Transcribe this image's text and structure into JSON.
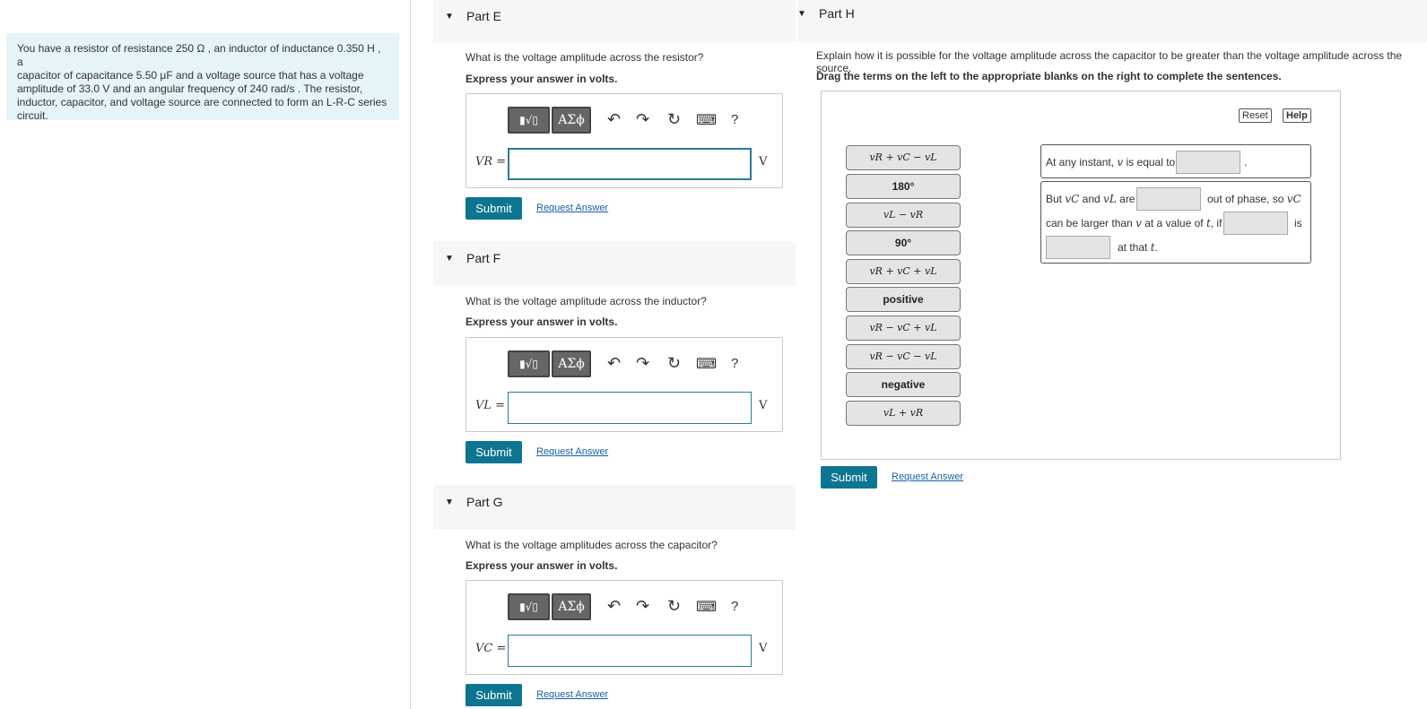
{
  "problem": {
    "p1": "You have a resistor of resistance 250 Ω , an inductor of inductance 0.350 H , a",
    "p2": "capacitor of capacitance 5.50 μF and a voltage source that has a voltage",
    "p3": "amplitude of 33.0 V and an angular frequency of 240 rad/s . The resistor,",
    "p4": "inductor, capacitor, and voltage source are connected to form an L-R-C series",
    "p5": "circuit."
  },
  "toolbar": {
    "template_glyph": "▮√▯",
    "greek_glyph": "ΑΣϕ",
    "undo_glyph": "↶",
    "redo_glyph": "↷",
    "reset_glyph": "↻",
    "keyboard_glyph": "⌨",
    "help_glyph": "?"
  },
  "common": {
    "express": "Express your answer in volts.",
    "submit": "Submit",
    "request": "Request Answer",
    "unit": "V"
  },
  "partE": {
    "title": "Part E",
    "question": "What is the voltage amplitude across the resistor?",
    "var": "VR ="
  },
  "partF": {
    "title": "Part F",
    "question": "What is the voltage amplitude across the inductor?",
    "var": "VL ="
  },
  "partG": {
    "title": "Part G",
    "question": "What is the voltage amplitudes across the capacitor?",
    "var": "VC ="
  },
  "partH": {
    "title": "Part H",
    "question": "Explain how it is possible for the voltage amplitude across the capacitor to be greater than the voltage amplitude across the source.",
    "instruction": "Drag the terms on the left to the appropriate blanks on the right to complete the sentences.",
    "reset": "Reset",
    "help": "Help",
    "terms": [
      "vR + vC − vL",
      "180°",
      "vL − vR",
      "90°",
      "vR + vC + vL",
      "positive",
      "vR − vC + vL",
      "vR − vC − vL",
      "negative",
      "vL + vR"
    ],
    "s1a": "At any instant,",
    "s1b": "v",
    "s1c": "is equal to",
    "s1d": ".",
    "s2a": "But",
    "s2b": "vC",
    "s2c": "and",
    "s2d": "vL",
    "s2e": "are",
    "s2f": "out of phase, so",
    "s2g": "vC",
    "s3a": "can be larger than",
    "s3b": "v",
    "s3c": "at a value of",
    "s3d": "t",
    "s3e": ", if",
    "s3f": "is",
    "s4a": "at that",
    "s4b": "t",
    "s4c": "."
  }
}
